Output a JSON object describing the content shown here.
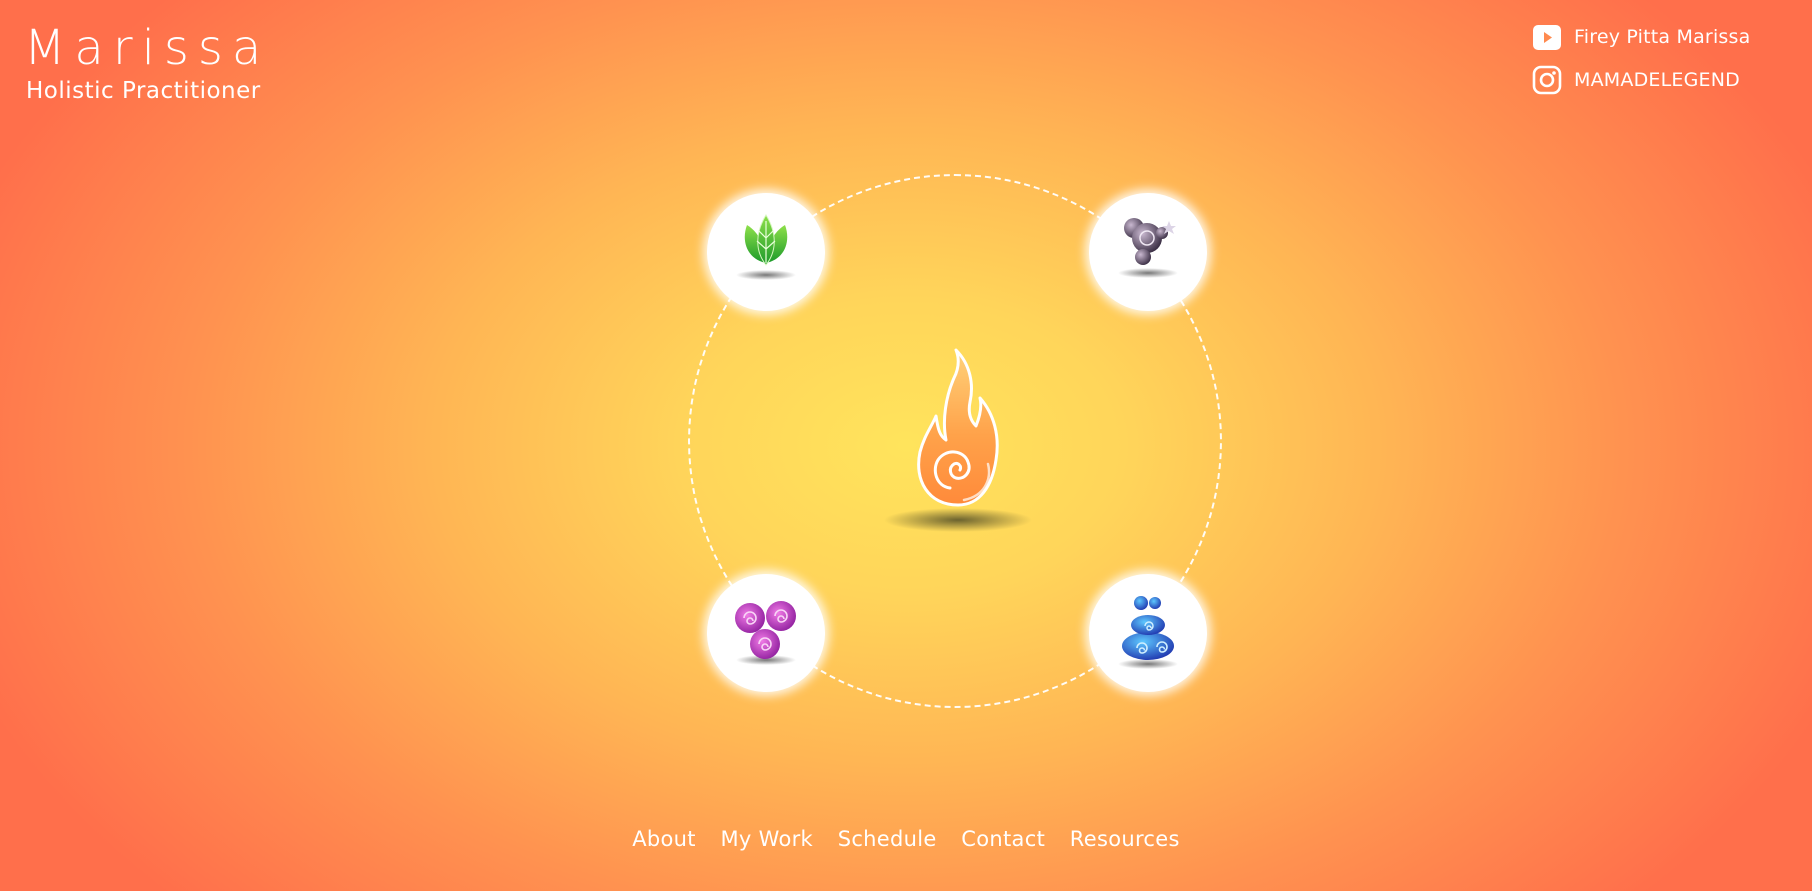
{
  "brand": {
    "name": "Marissa",
    "subtitle": "Holistic Practitioner"
  },
  "social": [
    {
      "icon": "youtube-icon",
      "label": "Firey Pitta Marissa"
    },
    {
      "icon": "instagram-icon",
      "label": "MAMADELEGEND"
    }
  ],
  "elements": {
    "center": "fire-icon",
    "nodes": [
      "leaf-icon",
      "air-bubbles-icon",
      "spiral-icon",
      "water-swirl-icon"
    ]
  },
  "nav": {
    "items": [
      "About",
      "My Work",
      "Schedule",
      "Contact",
      "Resources"
    ]
  },
  "colors": {
    "background_center": "#ffe45c",
    "background_edge": "#ff6f4b",
    "text": "#ffffff"
  }
}
